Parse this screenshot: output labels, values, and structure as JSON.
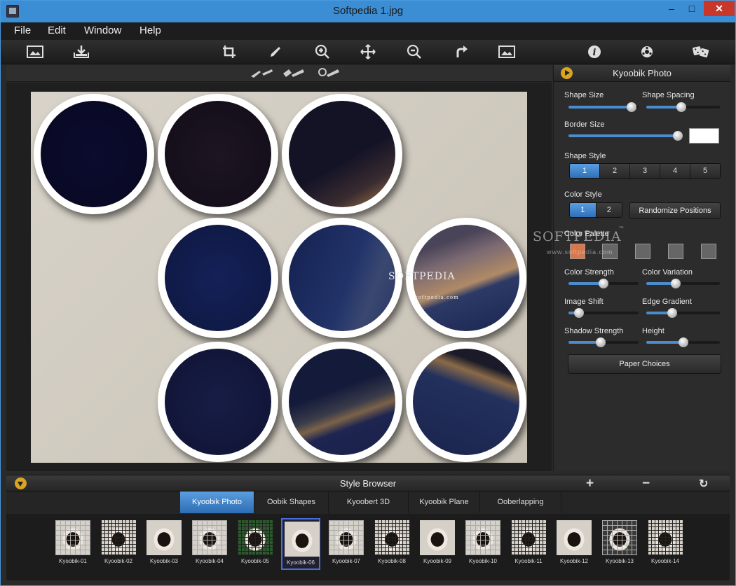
{
  "window": {
    "title": "Softpedia 1.jpg",
    "min": "–",
    "max": "□",
    "close": "✕"
  },
  "menu": [
    "File",
    "Edit",
    "Window",
    "Help"
  ],
  "toolbar": {
    "icons": [
      "open-image-icon",
      "save-icon",
      "crop-icon",
      "retouch-icon",
      "zoom-in-icon",
      "move-icon",
      "zoom-out-icon",
      "redo-icon",
      "fit-image-icon",
      "info-icon",
      "settings-icon",
      "dice-icon"
    ]
  },
  "right_panel": {
    "title": "Kyoobik Photo",
    "shape_size": "Shape Size",
    "shape_spacing": "Shape Spacing",
    "border_size": "Border Size",
    "shape_style": "Shape Style",
    "shape_style_options": [
      "1",
      "2",
      "3",
      "4",
      "5"
    ],
    "color_style": "Color Style",
    "color_style_options": [
      "1",
      "2"
    ],
    "randomize": "Randomize Positions",
    "color_palette": "Color Palette",
    "color_strength": "Color Strength",
    "color_variation": "Color Variation",
    "image_shift": "Image Shift",
    "edge_gradient": "Edge Gradient",
    "shadow_strength": "Shadow Strength",
    "height": "Height",
    "paper_choices": "Paper Choices",
    "palette_colors": [
      "#d9774a",
      "#666666",
      "#666666",
      "#666666",
      "#666666"
    ],
    "sliders": {
      "shape_size": 0.9,
      "shape_spacing": 0.48,
      "border_size": 0.96,
      "color_strength": 0.5,
      "color_variation": 0.4,
      "image_shift": 0.15,
      "edge_gradient": 0.35,
      "shadow_strength": 0.46,
      "height": 0.5
    }
  },
  "watermark": {
    "main": "SOFTPEDIA",
    "sub": "www.softpedia.com",
    "tm": "™",
    "center": "SOFTPEDIA",
    "center_url": "softpedia.com"
  },
  "browser": {
    "title": "Style Browser",
    "add": "+",
    "remove": "−",
    "refresh": "↻",
    "tabs": [
      "Kyoobik Photo",
      "Oobik Shapes",
      "Kyoobert 3D",
      "Kyoobik Plane",
      "Ooberlapping"
    ],
    "thumbs": [
      "Kyoobik-01",
      "Kyoobik-02",
      "Kyoobik-03",
      "Kyoobik-04",
      "Kyoobik-05",
      "Kyoobik-06",
      "Kyoobik-07",
      "Kyoobik-08",
      "Kyoobik-09",
      "Kyoobik-10",
      "Kyoobik-11",
      "Kyoobik-12",
      "Kyoobik-13",
      "Kyoobik-14"
    ]
  }
}
